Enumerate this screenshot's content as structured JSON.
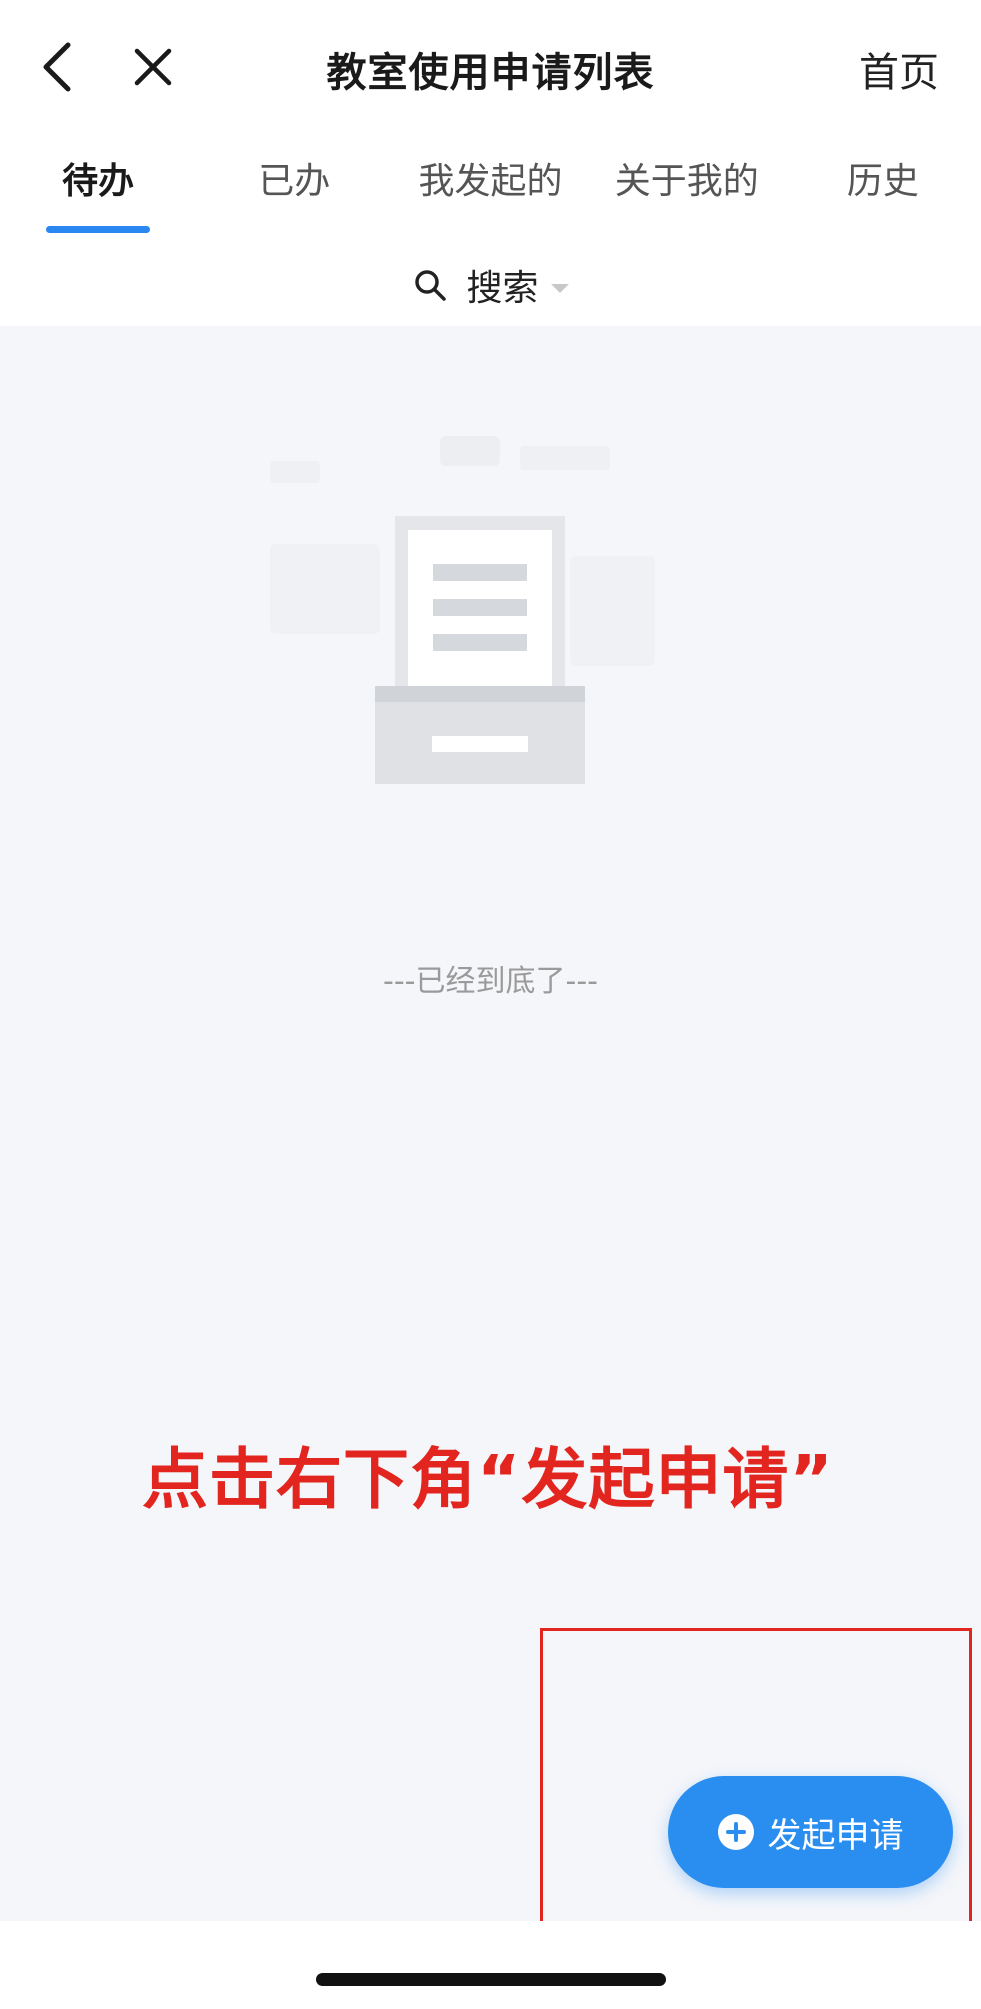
{
  "header": {
    "title": "教室使用申请列表",
    "home_label": "首页",
    "back_icon": "chevron-left-icon",
    "close_icon": "close-icon"
  },
  "tabs": [
    {
      "label": "待办",
      "active": true
    },
    {
      "label": "已办",
      "active": false
    },
    {
      "label": "我发起的",
      "active": false
    },
    {
      "label": "关于我的",
      "active": false
    },
    {
      "label": "历史",
      "active": false
    }
  ],
  "search": {
    "label": "搜索",
    "icon": "search-icon"
  },
  "empty_state": {
    "illustration": "empty-document-tray-icon",
    "end_text": "---已经到底了---"
  },
  "annotation": {
    "hint": "点击右下角“发起申请”",
    "color": "#e2251f"
  },
  "fab": {
    "label": "发起申请",
    "icon": "plus-circle-icon"
  },
  "colors": {
    "accent": "#2a86f0",
    "background": "#f5f6fa",
    "annotation": "#e2251f"
  }
}
